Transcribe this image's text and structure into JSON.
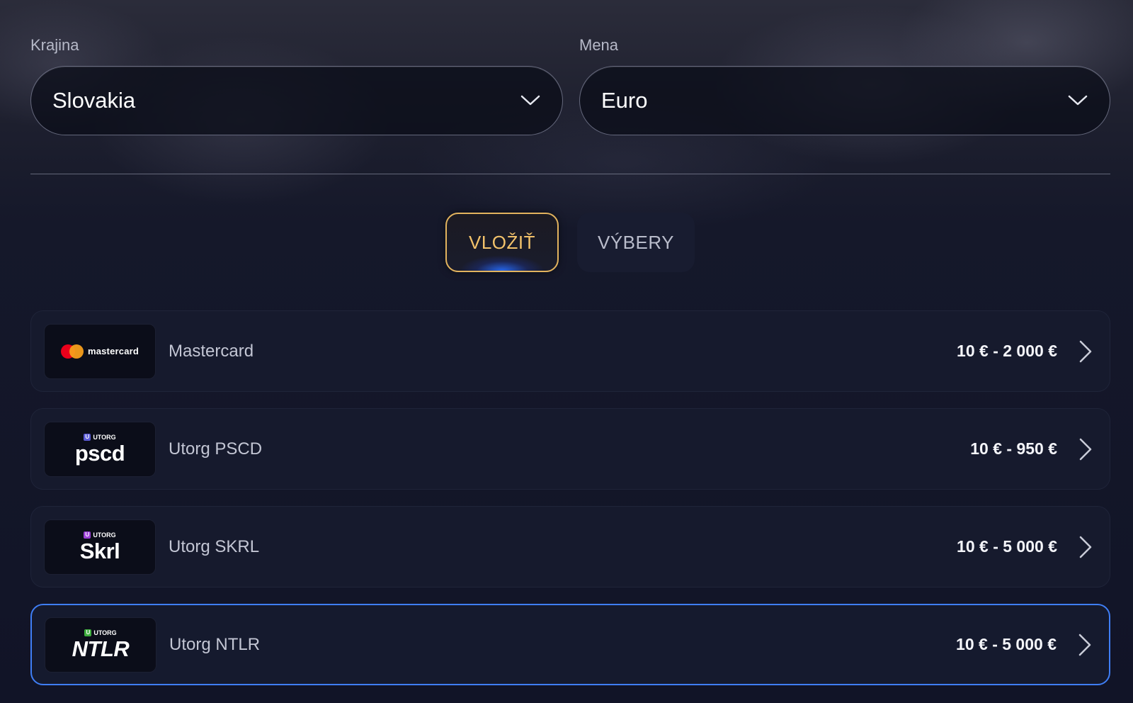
{
  "country": {
    "label": "Krajina",
    "value": "Slovakia"
  },
  "currency": {
    "label": "Mena",
    "value": "Euro"
  },
  "tabs": {
    "deposit": "VLOŽIŤ",
    "withdrawals": "VÝBERY"
  },
  "payment_methods": [
    {
      "name": "Mastercard",
      "range": "10 € - 2 000 €",
      "logo": {
        "text": "mastercard"
      }
    },
    {
      "name": "Utorg PSCD",
      "range": "10 € - 950 €",
      "logo": {
        "badge": "U",
        "top": "UTORG",
        "main": "pscd",
        "badge_color": "#5b5bd6"
      }
    },
    {
      "name": "Utorg SKRL",
      "range": "10 € - 5 000 €",
      "logo": {
        "badge": "U",
        "top": "UTORG",
        "main": "Skrl",
        "badge_color": "#9b3fd6"
      }
    },
    {
      "name": "Utorg NTLR",
      "range": "10 € - 5 000 €",
      "logo": {
        "badge": "U",
        "top": "UTORG",
        "main": "NTLR",
        "badge_color": "#3fae3f"
      }
    }
  ],
  "colors": {
    "accent_gold": "#e2b35e",
    "selected_border": "#3f7ef5"
  },
  "icons": {
    "dropdown": "chevron-down-icon",
    "row_arrow": "chevron-right-icon"
  }
}
